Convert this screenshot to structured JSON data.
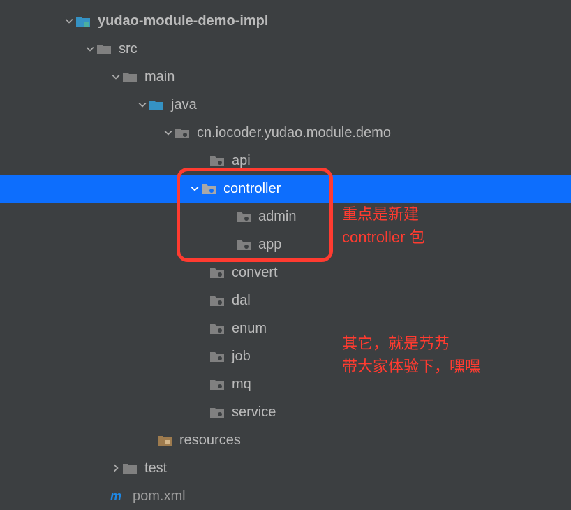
{
  "tree": {
    "root": {
      "label": "yudao-module-demo-impl",
      "expanded": true,
      "iconType": "module",
      "children": {
        "src": {
          "label": "src",
          "expanded": true,
          "iconType": "folder",
          "children": {
            "main": {
              "label": "main",
              "expanded": true,
              "iconType": "folder",
              "children": {
                "java": {
                  "label": "java",
                  "expanded": true,
                  "iconType": "source",
                  "children": {
                    "pkg": {
                      "label": "cn.iocoder.yudao.module.demo",
                      "expanded": true,
                      "iconType": "package",
                      "children": {
                        "api": {
                          "label": "api",
                          "iconType": "package"
                        },
                        "controller": {
                          "label": "controller",
                          "expanded": true,
                          "selected": true,
                          "iconType": "package",
                          "children": {
                            "admin": {
                              "label": "admin",
                              "iconType": "package"
                            },
                            "app": {
                              "label": "app",
                              "iconType": "package"
                            }
                          }
                        },
                        "convert": {
                          "label": "convert",
                          "iconType": "package"
                        },
                        "dal": {
                          "label": "dal",
                          "iconType": "package"
                        },
                        "enumPkg": {
                          "label": "enum",
                          "iconType": "package"
                        },
                        "job": {
                          "label": "job",
                          "iconType": "package"
                        },
                        "mq": {
                          "label": "mq",
                          "iconType": "package"
                        },
                        "service": {
                          "label": "service",
                          "iconType": "package"
                        }
                      }
                    }
                  }
                },
                "resources": {
                  "label": "resources",
                  "iconType": "resources"
                }
              }
            },
            "test": {
              "label": "test",
              "expanded": false,
              "iconType": "folder",
              "hasChildren": true
            }
          }
        },
        "pom": {
          "label": "pom.xml",
          "iconType": "maven"
        }
      }
    }
  },
  "annotation1_line1": "重点是新建",
  "annotation1_line2": "controller 包",
  "annotation2_line1": "其它，就是艿艿",
  "annotation2_line2": "带大家体验下，嘿嘿",
  "colors": {
    "selection": "#0d6efd",
    "annotation": "#ff3b30",
    "source_folder": "#3592c4",
    "resources_folder": "#9e7b4e",
    "package": "#808080",
    "maven": "#1e88e5"
  }
}
